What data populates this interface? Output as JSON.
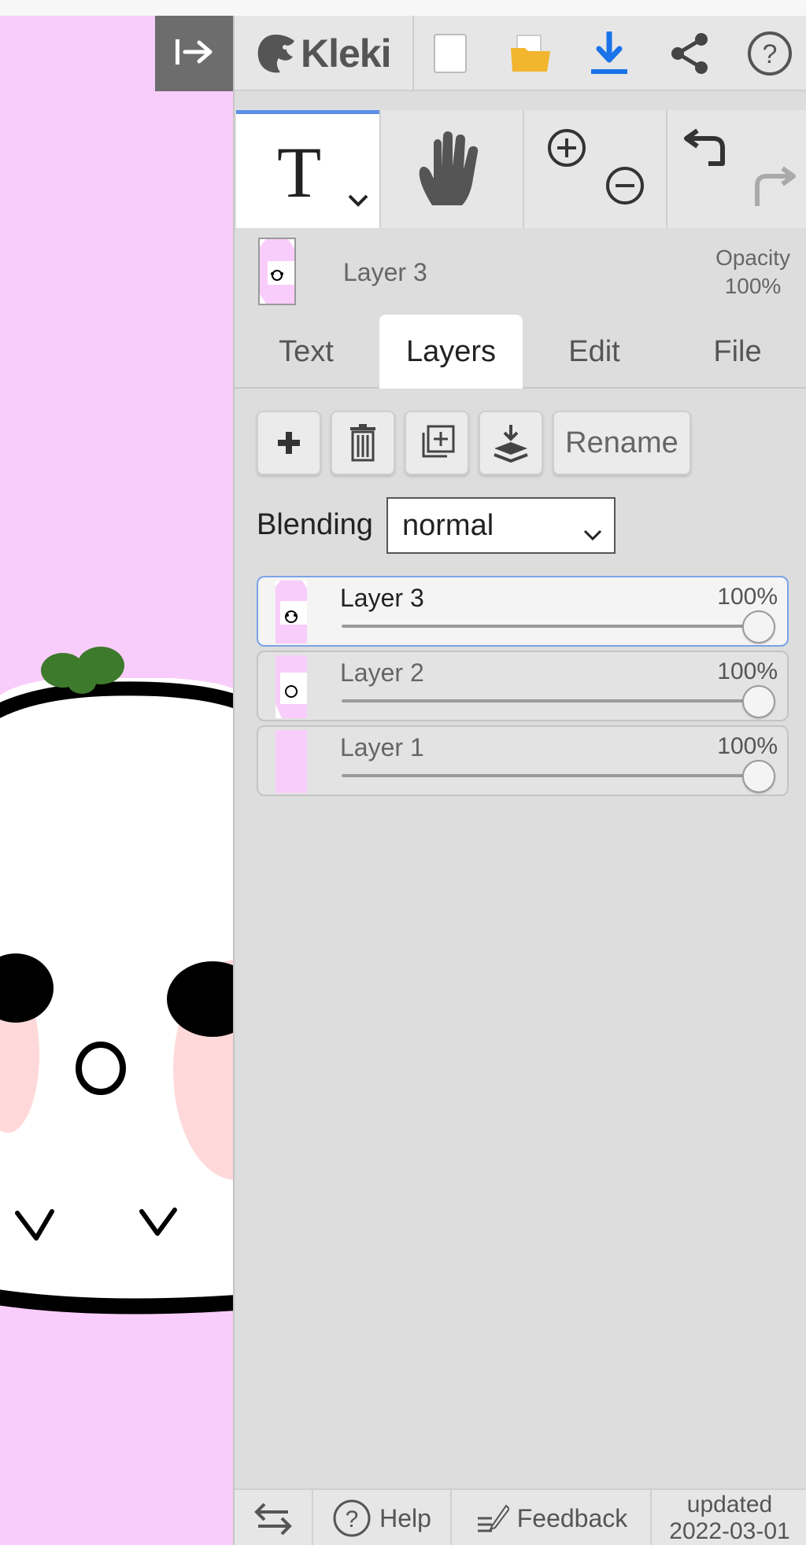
{
  "app": {
    "logo_text": "Kleki"
  },
  "canvas": {
    "background": "#f9cdfb",
    "collapse_icon": "collapse-right-icon"
  },
  "topbar": {
    "icons": [
      "new-image-icon",
      "open-folder-icon",
      "download-icon",
      "share-icon",
      "help-icon"
    ]
  },
  "tools": {
    "active": "text-tool",
    "items": [
      "text-tool",
      "hand-tool",
      "zoom",
      "undo-redo"
    ]
  },
  "current_layer": {
    "name": "Layer 3",
    "opacity_label": "Opacity",
    "opacity_value": "100%"
  },
  "tabs": [
    {
      "label": "Text",
      "active": false
    },
    {
      "label": "Layers",
      "active": true
    },
    {
      "label": "Edit",
      "active": false
    },
    {
      "label": "File",
      "active": false
    }
  ],
  "layer_actions": {
    "rename_label": "Rename"
  },
  "blending": {
    "label": "Blending",
    "value": "normal"
  },
  "layers": [
    {
      "name": "Layer 3",
      "opacity": "100%",
      "opacity_fraction": 1.0,
      "selected": true
    },
    {
      "name": "Layer 2",
      "opacity": "100%",
      "opacity_fraction": 1.0,
      "selected": false
    },
    {
      "name": "Layer 1",
      "opacity": "100%",
      "opacity_fraction": 1.0,
      "selected": false
    }
  ],
  "bottombar": {
    "help_label": "Help",
    "feedback_label": "Feedback",
    "updated_label": "updated",
    "updated_date": "2022-03-01"
  },
  "colors": {
    "accent": "#5a8fe8",
    "sidebar_bg": "#dddddd",
    "canvas_pink": "#f9cdfb"
  }
}
